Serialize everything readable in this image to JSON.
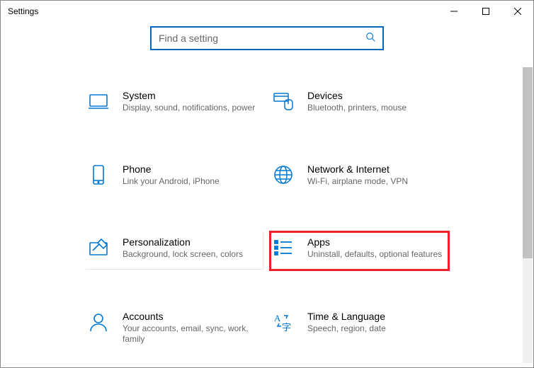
{
  "window": {
    "title": "Settings"
  },
  "search": {
    "placeholder": "Find a setting"
  },
  "tiles": {
    "system": {
      "title": "System",
      "sub": "Display, sound, notifications, power"
    },
    "devices": {
      "title": "Devices",
      "sub": "Bluetooth, printers, mouse"
    },
    "phone": {
      "title": "Phone",
      "sub": "Link your Android, iPhone"
    },
    "network": {
      "title": "Network & Internet",
      "sub": "Wi-Fi, airplane mode, VPN"
    },
    "personalization": {
      "title": "Personalization",
      "sub": "Background, lock screen, colors"
    },
    "apps": {
      "title": "Apps",
      "sub": "Uninstall, defaults, optional features"
    },
    "accounts": {
      "title": "Accounts",
      "sub": "Your accounts, email, sync, work, family"
    },
    "time": {
      "title": "Time & Language",
      "sub": "Speech, region, date"
    }
  }
}
